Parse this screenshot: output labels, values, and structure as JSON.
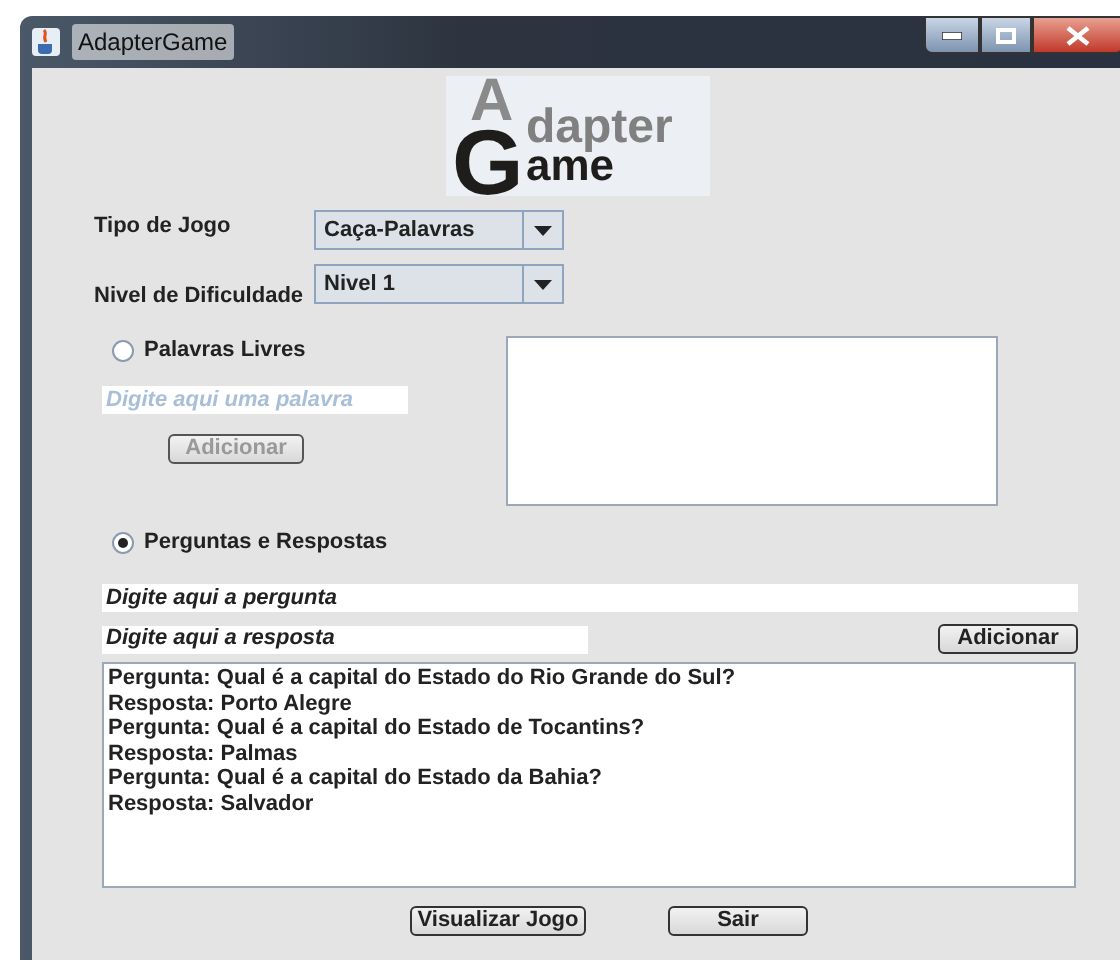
{
  "window": {
    "title": "AdapterGame"
  },
  "logo": {
    "letter_a": "A",
    "top_word": "dapter",
    "letter_g": "G",
    "bottom_word": "ame"
  },
  "fields": [
    {
      "kind": "combo",
      "label": "Tipo de Jogo",
      "value": "Caça-Palavras"
    },
    {
      "kind": "combo",
      "label": "Nivel de Dificuldade",
      "value": "Nivel 1"
    }
  ],
  "free_words": {
    "label": "Palavras Livres",
    "selected": false,
    "placeholder": "Digite aqui uma palavra",
    "button": {
      "label": "Adicionar",
      "disabled": true
    }
  },
  "questions": {
    "label": "Perguntas e Respostas",
    "selected": true,
    "question_value": "Digite aqui a pergunta",
    "answer_value": "Digite aqui a resposta",
    "button": {
      "label": "Adicionar",
      "disabled": false
    },
    "lines": [
      "Pergunta: Qual é a capital do Estado do Rio Grande do Sul?",
      "Resposta: Porto Alegre",
      "Pergunta: Qual é a capital do Estado de Tocantins?",
      "Resposta: Palmas",
      "Pergunta: Qual é a capital do Estado da Bahia?",
      "Resposta: Salvador"
    ]
  },
  "buttons": [
    "Visualizar Jogo",
    "Sair"
  ]
}
